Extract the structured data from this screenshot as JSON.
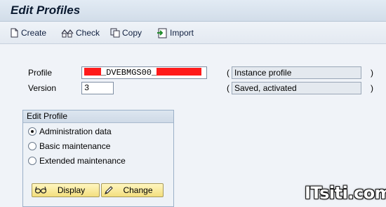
{
  "window": {
    "title": "Edit Profiles"
  },
  "toolbar": {
    "buttons": [
      {
        "label": "Create",
        "icon": "document-new-icon"
      },
      {
        "label": "Check",
        "icon": "check-icon"
      },
      {
        "label": "Copy",
        "icon": "copy-icon"
      },
      {
        "label": "Import",
        "icon": "import-icon"
      }
    ]
  },
  "form": {
    "profile": {
      "label": "Profile",
      "value_visible": "_DVEBMGS00_",
      "description": "Instance profile"
    },
    "version": {
      "label": "Version",
      "value": "3",
      "description": "Saved, activated"
    },
    "paren_open": "(",
    "paren_close": ")"
  },
  "edit_group": {
    "title": "Edit Profile",
    "options": [
      {
        "label": "Administration data",
        "selected": true
      },
      {
        "label": "Basic maintenance",
        "selected": false
      },
      {
        "label": "Extended maintenance",
        "selected": false
      }
    ],
    "buttons": {
      "display": "Display",
      "change": "Change"
    }
  },
  "watermark": "ITsiti.com",
  "colors": {
    "redaction": "#ff1a1a",
    "button_yellow": "#f3df7e",
    "title_bar": "#d2dde9"
  }
}
